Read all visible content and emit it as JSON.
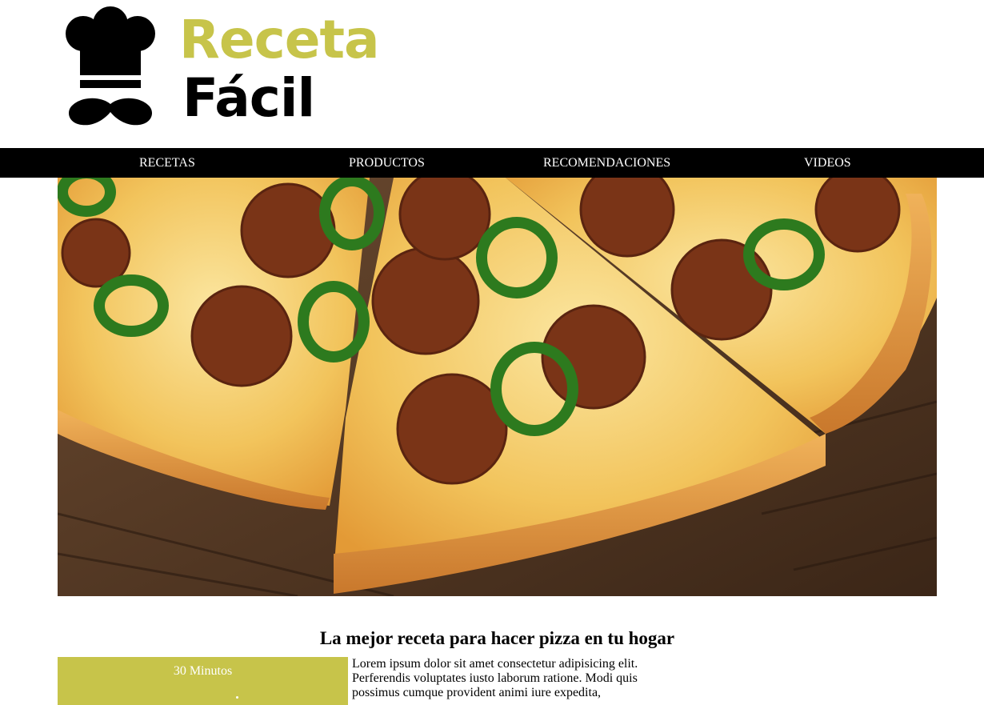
{
  "brand": {
    "line1": "Receta",
    "line2": "Fácil",
    "icon": "chef-hat-mustache-icon",
    "accent_color": "#c7c44a"
  },
  "nav": {
    "items": [
      {
        "label": "RECETAS"
      },
      {
        "label": "PRODUCTOS"
      },
      {
        "label": "RECOMENDACIONES"
      },
      {
        "label": "VIDEOS"
      }
    ]
  },
  "hero": {
    "image": "pizza-photo"
  },
  "article": {
    "title": "La mejor receta para hacer pizza en tu hogar",
    "time_label": "30 Minutos",
    "body": "Lorem ipsum dolor sit amet consectetur adipisicing elit. Perferendis voluptates iusto laborum ratione. Modi quis possimus cumque provident animi iure expedita,"
  }
}
